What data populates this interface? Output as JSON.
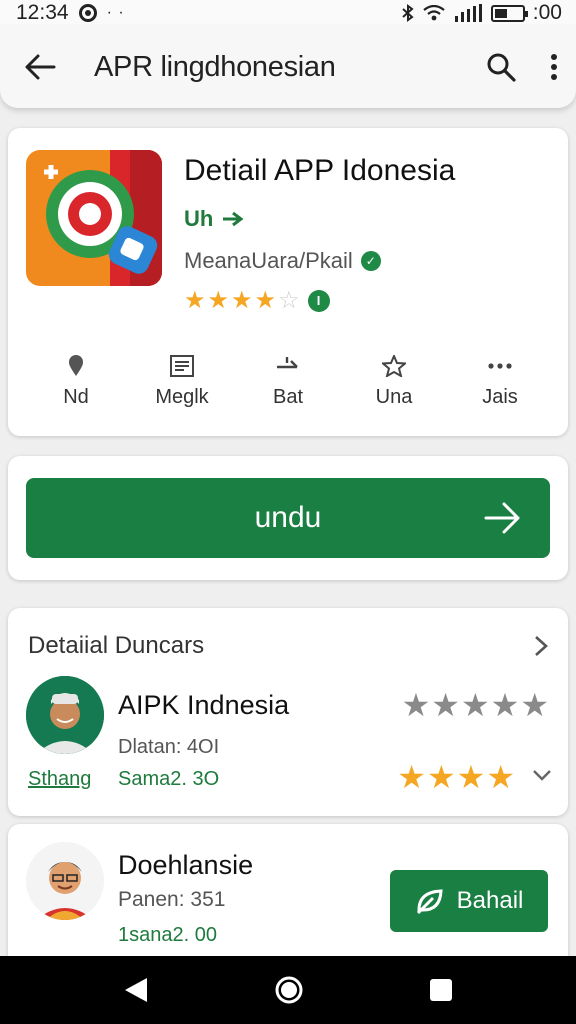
{
  "status_bar": {
    "time": "12:34",
    "extra_dots": "· ·",
    "battery_text": ":00"
  },
  "app_bar": {
    "title": "APR lingdhonesian",
    "icons": [
      "back-arrow-icon",
      "search-icon",
      "more-vert-icon"
    ]
  },
  "app_card": {
    "title": "Detiail APP Idonesia",
    "tag": "Uh",
    "developer": "MeanaUara/Pkail",
    "rating": 4,
    "rating_max": 5,
    "rating_badge": "I",
    "stats": [
      {
        "icon": "location-pin-icon",
        "label": "Nd"
      },
      {
        "icon": "document-icon",
        "label": "Meglk"
      },
      {
        "icon": "share-icon",
        "label": "Bat"
      },
      {
        "icon": "star-outline-icon",
        "label": "Una"
      },
      {
        "icon": "more-horiz-icon",
        "label": "Jais"
      }
    ]
  },
  "install": {
    "label": "undu"
  },
  "reviews": {
    "header": "Detaiial Duncars",
    "items": [
      {
        "name": "AIPK Indnesia",
        "meta": "Dlatan: 4OI",
        "tag": "Sthang",
        "date": "Sama2. 3O",
        "stars_grey": "★★★★★",
        "stars_gold": "★★★★"
      },
      {
        "name": "Doehlansie",
        "meta": "Panen: 351",
        "date": "1sana2. 00",
        "button_label": "Bahail"
      }
    ]
  },
  "colors": {
    "accent_green": "#1a7f42",
    "star_gold": "#f5a623",
    "star_grey": "#8a8a8a"
  }
}
